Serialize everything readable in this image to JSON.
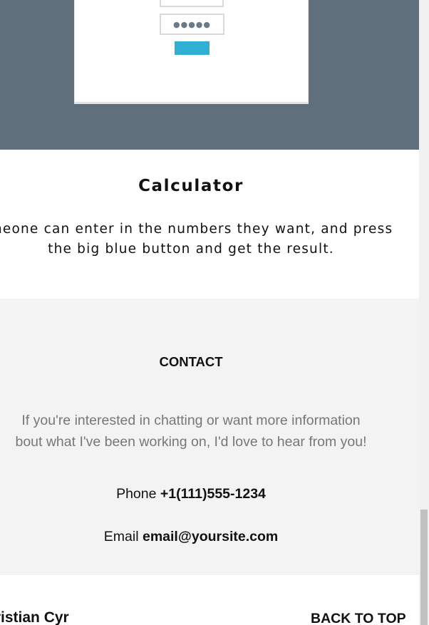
{
  "project": {
    "mock_password": "●●●●●",
    "title": "Calculator",
    "description_line1": "meone can enter in the numbers they want, and press",
    "description_line2": "the big blue button and get the result."
  },
  "contact": {
    "heading": "CONTACT",
    "intro_line1": "If you're interested in chatting or want more information",
    "intro_line2": "bout what I've been working on, I'd love to hear from you!",
    "phone_label": "Phone ",
    "phone_value": "+1(111)555-1234",
    "email_label": "Email ",
    "email_value": "email@yoursite.com"
  },
  "footer": {
    "name": "ıristian Cyr",
    "back_to_top": "BACK TO TOP"
  },
  "colors": {
    "band": "#5f6f7c",
    "accent_button": "#2fb0d3",
    "contact_bg": "#f3f3f3",
    "muted_text": "#777777"
  },
  "scrollbar": {
    "scroll_position": 1.0
  }
}
